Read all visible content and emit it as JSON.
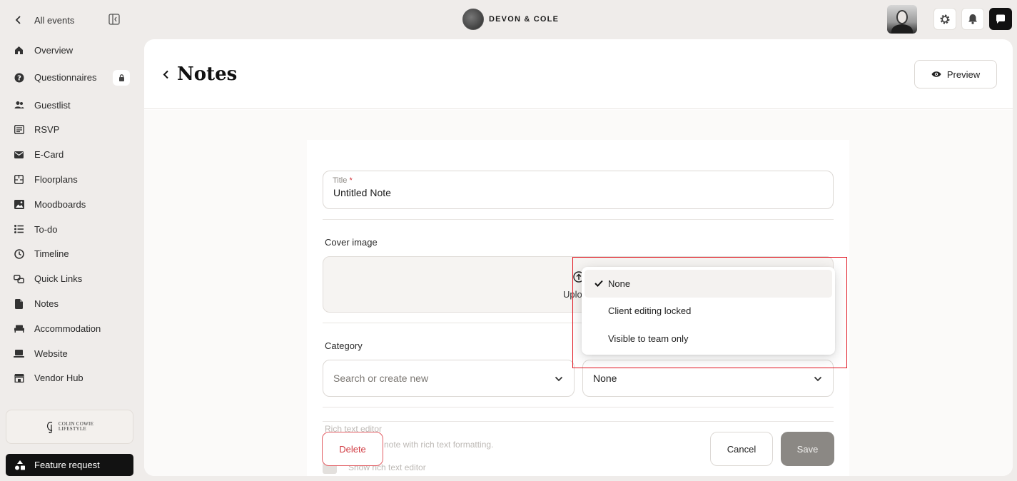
{
  "sidebar": {
    "back_label": "All events",
    "items": [
      {
        "label": "Overview",
        "icon": "home-icon"
      },
      {
        "label": "Questionnaires",
        "icon": "question-circle-icon",
        "locked": true
      },
      {
        "label": "Guestlist",
        "icon": "users-icon"
      },
      {
        "label": "RSVP",
        "icon": "rsvp-icon"
      },
      {
        "label": "E-Card",
        "icon": "envelope-icon"
      },
      {
        "label": "Floorplans",
        "icon": "floorplan-icon"
      },
      {
        "label": "Moodboards",
        "icon": "image-icon"
      },
      {
        "label": "To-do",
        "icon": "list-icon"
      },
      {
        "label": "Timeline",
        "icon": "clock-icon"
      },
      {
        "label": "Quick Links",
        "icon": "link-icon"
      },
      {
        "label": "Notes",
        "icon": "document-icon"
      },
      {
        "label": "Accommodation",
        "icon": "bed-icon"
      },
      {
        "label": "Website",
        "icon": "laptop-icon"
      },
      {
        "label": "Vendor Hub",
        "icon": "store-icon"
      }
    ],
    "brand_card": {
      "line1": "COLIN COWIE",
      "line2": "LIFESTYLE"
    },
    "feature_request": "Feature request"
  },
  "topbar": {
    "brand_name": "DEVON & COLE"
  },
  "page": {
    "title": "Notes",
    "preview_label": "Preview"
  },
  "form": {
    "title_label": "Title",
    "title_required": "*",
    "title_value": "Untitled Note",
    "cover_label": "Cover image",
    "upload_text": "Uplo",
    "category_label": "Category",
    "category_placeholder": "Search or create new",
    "visibility_value": "None",
    "rich_text_label": "Rich text editor",
    "rich_text_desc": "note with rich text formatting.",
    "rich_text_toggle": "Show rich text editor"
  },
  "dropdown": {
    "options": [
      {
        "label": "None",
        "selected": true
      },
      {
        "label": "Client editing locked",
        "selected": false
      },
      {
        "label": "Visible to team only",
        "selected": false
      }
    ]
  },
  "actions": {
    "delete": "Delete",
    "cancel": "Cancel",
    "save": "Save"
  },
  "colors": {
    "accent_danger": "#d13a41",
    "highlight": "#e0141f",
    "save_disabled": "#8b8884"
  }
}
